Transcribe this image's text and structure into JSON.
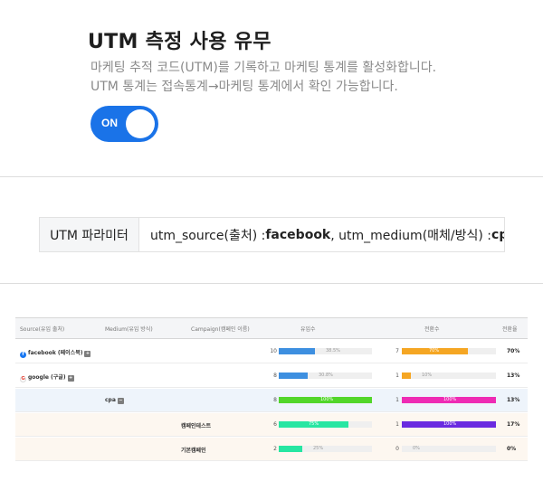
{
  "settings": {
    "title": "UTM 측정 사용 유무",
    "description_line1": "마케팅 추적 코드(UTM)를 기록하고 마케팅 통계를 활성화합니다.",
    "description_line2": "UTM 통계는 접속통계→마케팅 통계에서 확인 가능합니다.",
    "toggle_label": "ON",
    "toggle_state": true
  },
  "utm_param": {
    "label": "UTM 파라미터",
    "source_key": "utm_source(출처) : ",
    "source_value": "facebook",
    "medium_key": ", utm_medium(매체/방식) : ",
    "medium_value": "cpc"
  },
  "stats_table": {
    "headers": {
      "source": "Source(유입 출처)",
      "medium": "Medium(유입 방식)",
      "campaign": "Campaign(캠페인 이름)",
      "visits": "유입수",
      "conversions": "전환수",
      "rate": "전환율"
    },
    "rows": [
      {
        "level": "source",
        "icon": "facebook-icon",
        "label": "facebook (페이스북)",
        "badge": "+",
        "visits": "10",
        "visits_pct_label": "38.5%",
        "visits_fraction": 0.385,
        "visits_color": "#3d8fe0",
        "conv": "7",
        "conv_pct_label": "70%",
        "conv_fraction": 0.7,
        "conv_color": "#f5a623",
        "rate": "70%"
      },
      {
        "level": "source",
        "icon": "google-icon",
        "label": "google (구글)",
        "badge": "+",
        "visits": "8",
        "visits_pct_label": "30.8%",
        "visits_fraction": 0.308,
        "visits_color": "#3d8fe0",
        "conv": "1",
        "conv_pct_label": "10%",
        "conv_fraction": 0.1,
        "conv_color": "#f5a623",
        "rate": "13%"
      },
      {
        "level": "medium",
        "icon": "",
        "label": "cpa",
        "badge": "−",
        "visits": "8",
        "visits_pct_label": "100%",
        "visits_fraction": 1.0,
        "visits_color": "#52d62a",
        "conv": "1",
        "conv_pct_label": "100%",
        "conv_fraction": 1.0,
        "conv_color": "#ee2bb4",
        "rate": "13%"
      },
      {
        "level": "campaign",
        "icon": "",
        "label": "캠페인테스트",
        "badge": "",
        "visits": "6",
        "visits_pct_label": "75%",
        "visits_fraction": 0.75,
        "visits_color": "#27e6a2",
        "conv": "1",
        "conv_pct_label": "100%",
        "conv_fraction": 1.0,
        "conv_color": "#6a2be0",
        "rate": "17%"
      },
      {
        "level": "campaign",
        "icon": "",
        "label": "기본캠페인",
        "badge": "",
        "visits": "2",
        "visits_pct_label": "25%",
        "visits_fraction": 0.25,
        "visits_color": "#27e6a2",
        "conv": "0",
        "conv_pct_label": "0%",
        "conv_fraction": 0.0,
        "conv_color": "#6a2be0",
        "rate": "0%"
      }
    ]
  },
  "colors": {
    "accent": "#1a73e8"
  }
}
